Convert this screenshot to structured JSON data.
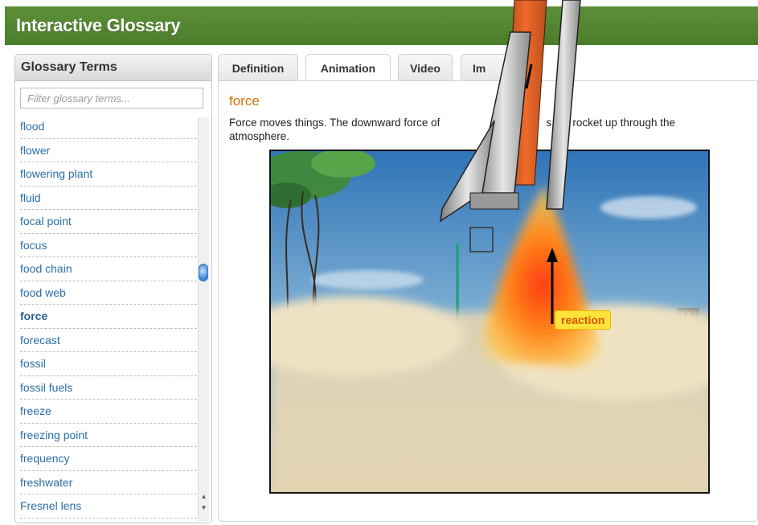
{
  "app": {
    "title": "Interactive Glossary"
  },
  "sidebar": {
    "title": "Glossary Terms",
    "filter_placeholder": "Filter glossary terms...",
    "terms": [
      "flood",
      "flower",
      "flowering plant",
      "fluid",
      "focal point",
      "focus",
      "food chain",
      "food web",
      "force",
      "forecast",
      "fossil",
      "fossil fuels",
      "freeze",
      "freezing point",
      "frequency",
      "freshwater",
      "Fresnel lens"
    ],
    "selected_term": "force"
  },
  "tabs": [
    "Definition",
    "Animation",
    "Video",
    "Im"
  ],
  "active_tab": "Animation",
  "content": {
    "term": "force",
    "definition": "Force moves things. The downward force of",
    "definition_tail": "s the rocket up through the",
    "definition_line2": "atmosphere.",
    "reaction_label": "reaction"
  },
  "colors": {
    "header_green": "#4a7c2b",
    "link_blue": "#2a6ea7",
    "term_orange": "#d8700b",
    "reaction_yellow": "#ffe33a"
  }
}
